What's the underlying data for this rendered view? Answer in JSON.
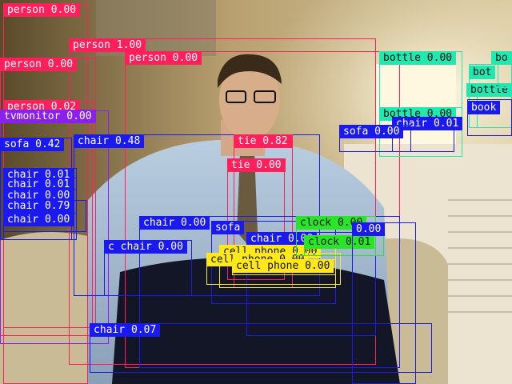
{
  "colors": {
    "person": "#ff1f5b",
    "tvmonitor": "#8a20f0",
    "sofa": "#1a1af0",
    "chair": "#1a1af0",
    "bottle": "#20e8b0",
    "tie": "#ff1f5b",
    "clock": "#26e626",
    "cell phone": "#ffe81a",
    "book": "#1a1af0"
  },
  "detections": [
    {
      "label": "person 0.00",
      "cls": "person"
    },
    {
      "label": "person 1.00",
      "cls": "person"
    },
    {
      "label": "person 0.00",
      "cls": "person"
    },
    {
      "label": "person 0.00",
      "cls": "person"
    },
    {
      "label": "person 0.02",
      "cls": "person"
    },
    {
      "label": "tvmonitor 0.00",
      "cls": "tvmonitor"
    },
    {
      "label": "sofa 0.42",
      "cls": "sofa"
    },
    {
      "label": "chair 0.48",
      "cls": "chair"
    },
    {
      "label": "tie 0.82",
      "cls": "tie"
    },
    {
      "label": "tie 0.00",
      "cls": "tie"
    },
    {
      "label": "chair 0.01",
      "cls": "chair"
    },
    {
      "label": "chair 0.01",
      "cls": "chair"
    },
    {
      "label": "chair 0.00",
      "cls": "chair"
    },
    {
      "label": "chair 0.79",
      "cls": "chair"
    },
    {
      "label": "chair 0.00",
      "cls": "chair"
    },
    {
      "label": "chair 0.00",
      "cls": "chair"
    },
    {
      "label": "sofa",
      "cls": "sofa"
    },
    {
      "label": "chair 0.00",
      "cls": "chair"
    },
    {
      "label": "c chair 0.00",
      "cls": "chair"
    },
    {
      "label": "chair 0.07",
      "cls": "chair"
    },
    {
      "label": "cell phone 0.00",
      "cls": "cell phone"
    },
    {
      "label": "cell phone 0.00",
      "cls": "cell phone"
    },
    {
      "label": "cell phone 0.00",
      "cls": "cell phone"
    },
    {
      "label": "clock 0.00",
      "cls": "clock"
    },
    {
      "label": "clock 0.01",
      "cls": "clock"
    },
    {
      "label": "0.00",
      "cls": "chair"
    },
    {
      "label": "bottle 0.00",
      "cls": "bottle"
    },
    {
      "label": "bottle 0.00",
      "cls": "bottle"
    },
    {
      "label": "bot",
      "cls": "bottle"
    },
    {
      "label": "bottle",
      "cls": "bottle"
    },
    {
      "label": "bo",
      "cls": "bottle"
    },
    {
      "label": "book",
      "cls": "book"
    },
    {
      "label": "chair 0.01",
      "cls": "chair"
    },
    {
      "label": "sofa 0.00",
      "cls": "sofa"
    }
  ]
}
